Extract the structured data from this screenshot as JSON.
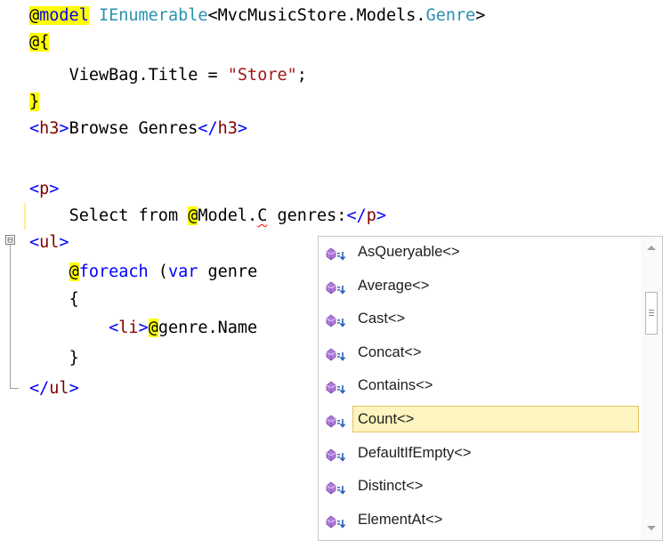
{
  "editor": {
    "lines": {
      "l1": {
        "at": "@",
        "model_kw": "model",
        "generic": "IEnumerable",
        "lt": "<",
        "ns": "MvcMusicStore.Models.",
        "genre_type": "Genre",
        "gt": ">"
      },
      "l2": {
        "at": "@",
        "brace": "{"
      },
      "l3": {
        "text": "ViewBag.Title = ",
        "str": "\"Store\"",
        "semi": ";"
      },
      "l4": {
        "brace": "}"
      },
      "l5": {
        "open": "<",
        "tag": "h3",
        "close": ">",
        "text": "Browse Genres",
        "open2": "</",
        "tag2": "h3",
        "close2": ">"
      },
      "l6": {
        "open": "<",
        "tag": "p",
        "close": ">"
      },
      "l7": {
        "text": "Select from ",
        "at": "@",
        "model": "Model.",
        "typed": "C",
        "rest": " genres:",
        "open2": "</",
        "tag2": "p",
        "close2": ">"
      },
      "l8": {
        "open": "<",
        "tag": "ul",
        "close": ">"
      },
      "l9": {
        "at": "@",
        "foreach_kw": "foreach",
        "paren": " (",
        "var_kw": "var",
        "rest": " genre"
      },
      "l10": {
        "brace": "{"
      },
      "l11": {
        "open": "<",
        "tag": "li",
        "close": ">",
        "at": "@",
        "rest": "genre.Name"
      },
      "l12": {
        "brace": "}"
      },
      "l13": {
        "open": "</",
        "tag": "ul",
        "close": ">"
      }
    },
    "outline_toggle": "⊟"
  },
  "intellisense": {
    "selected_index": 5,
    "items": [
      {
        "label": "AsQueryable<>"
      },
      {
        "label": "Average<>"
      },
      {
        "label": "Cast<>"
      },
      {
        "label": "Concat<>"
      },
      {
        "label": "Contains<>"
      },
      {
        "label": "Count<>"
      },
      {
        "label": "DefaultIfEmpty<>"
      },
      {
        "label": "Distinct<>"
      },
      {
        "label": "ElementAt<>"
      }
    ],
    "icon": "extension-method-icon"
  },
  "colors": {
    "keyword": "#0000ff",
    "type": "#2b91af",
    "string": "#a31515",
    "html_tag": "#800000",
    "razor_highlight": "#ffff00",
    "selection": "#fdf4bf"
  }
}
